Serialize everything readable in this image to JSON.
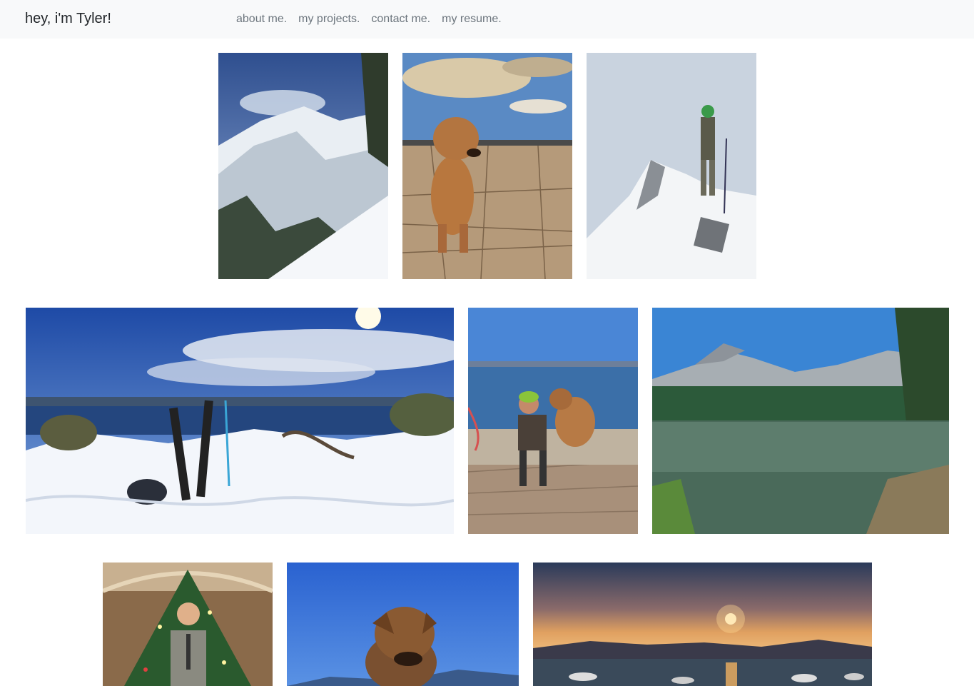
{
  "navbar": {
    "brand": "hey, i'm Tyler!",
    "links": [
      {
        "label": "about me."
      },
      {
        "label": "my projects."
      },
      {
        "label": "contact me."
      },
      {
        "label": "my resume."
      }
    ]
  },
  "gallery": {
    "photos": [
      {
        "subject": "snowy-mountain-peak"
      },
      {
        "subject": "dog-on-cracked-desert"
      },
      {
        "subject": "hiker-on-snowy-summit"
      },
      {
        "subject": "skis-in-snow-above-lake"
      },
      {
        "subject": "man-with-dog-by-lake"
      },
      {
        "subject": "alpine-lake-with-granite-peak"
      },
      {
        "subject": "man-at-christmas-tree"
      },
      {
        "subject": "dog-against-blue-sky"
      },
      {
        "subject": "sunset-over-lake-with-boats"
      }
    ]
  },
  "colors": {
    "navbar_bg": "#f8f9fa",
    "brand_text": "#212529",
    "nav_link_text": "#6c757d",
    "page_bg": "#ffffff"
  }
}
